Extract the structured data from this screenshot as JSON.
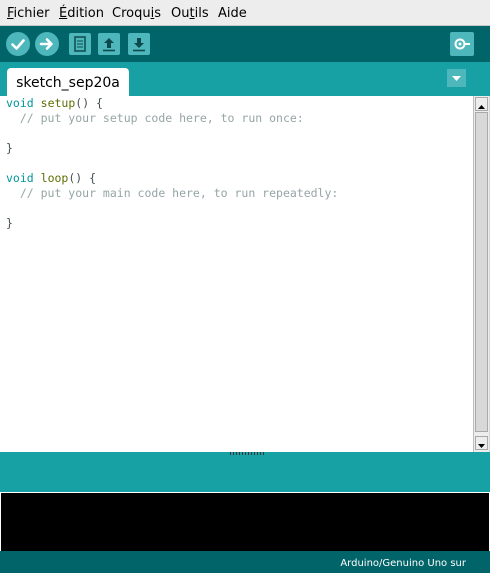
{
  "menu": {
    "items": [
      {
        "label": "Fichier"
      },
      {
        "label": "Édition"
      },
      {
        "label": "Croquis"
      },
      {
        "label": "Outils"
      },
      {
        "label": "Aide"
      }
    ]
  },
  "toolbar": {
    "buttons": [
      "verify-icon",
      "upload-icon",
      "new-icon",
      "open-icon",
      "save-icon",
      "serial-monitor-icon"
    ]
  },
  "tabs": {
    "active": "sketch_sep20a"
  },
  "editor": {
    "lines": [
      {
        "kw": "void",
        "fn": "setup",
        "rest": "() {"
      },
      {
        "comment": "  // put your setup code here, to run once:"
      },
      {
        "text": ""
      },
      {
        "text": "}"
      },
      {
        "text": ""
      },
      {
        "kw": "void",
        "fn": "loop",
        "rest": "() {"
      },
      {
        "comment": "  // put your main code here, to run repeatedly:"
      },
      {
        "text": ""
      },
      {
        "text": "}"
      }
    ]
  },
  "footer": {
    "board": "Arduino/Genuino Uno sur"
  },
  "colors": {
    "dark_teal": "#006468",
    "teal": "#17a1a5",
    "keyword": "#00979c",
    "function": "#5e6d03",
    "comment": "#95a5a6"
  }
}
